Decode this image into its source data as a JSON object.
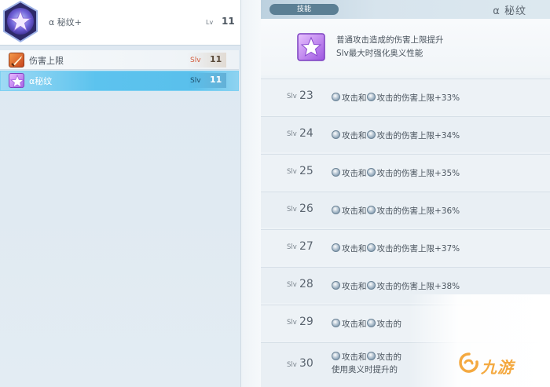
{
  "hero": {
    "name": "α 秘纹+",
    "lv_label": "Lv",
    "lv": "11"
  },
  "skill_list": [
    {
      "label": "伤害上限",
      "slv_label": "Slv",
      "slv": "11",
      "icon": "sword-icon"
    },
    {
      "label": "α秘纹",
      "slv_label": "Slv",
      "slv": "11",
      "icon": "star-icon"
    }
  ],
  "detail": {
    "tab": "技能",
    "title": "α 秘纹",
    "desc_line1": "普通攻击造成的伤害上限提升",
    "desc_line2": "Slv最大时强化奥义性能"
  },
  "levels": [
    {
      "slv_label": "Slv",
      "slv": "23",
      "text_a": "攻击和",
      "text_b": "攻击的伤害上限+33%"
    },
    {
      "slv_label": "Slv",
      "slv": "24",
      "text_a": "攻击和",
      "text_b": "攻击的伤害上限+34%"
    },
    {
      "slv_label": "Slv",
      "slv": "25",
      "text_a": "攻击和",
      "text_b": "攻击的伤害上限+35%"
    },
    {
      "slv_label": "Slv",
      "slv": "26",
      "text_a": "攻击和",
      "text_b": "攻击的伤害上限+36%"
    },
    {
      "slv_label": "Slv",
      "slv": "27",
      "text_a": "攻击和",
      "text_b": "攻击的伤害上限+37%"
    },
    {
      "slv_label": "Slv",
      "slv": "28",
      "text_a": "攻击和",
      "text_b": "攻击的伤害上限+38%"
    },
    {
      "slv_label": "Slv",
      "slv": "29",
      "text_a": "攻击和",
      "text_b": "攻击的"
    },
    {
      "slv_label": "Slv",
      "slv": "30",
      "text_a": "攻击和",
      "text_b": "攻击的",
      "text_line2": "使用奥义时提升的"
    }
  ],
  "watermark": "九游",
  "colors": {
    "selected_row": "#5cc3ee",
    "tab_bg": "#5b7f94",
    "watermark": "#f4a940"
  }
}
